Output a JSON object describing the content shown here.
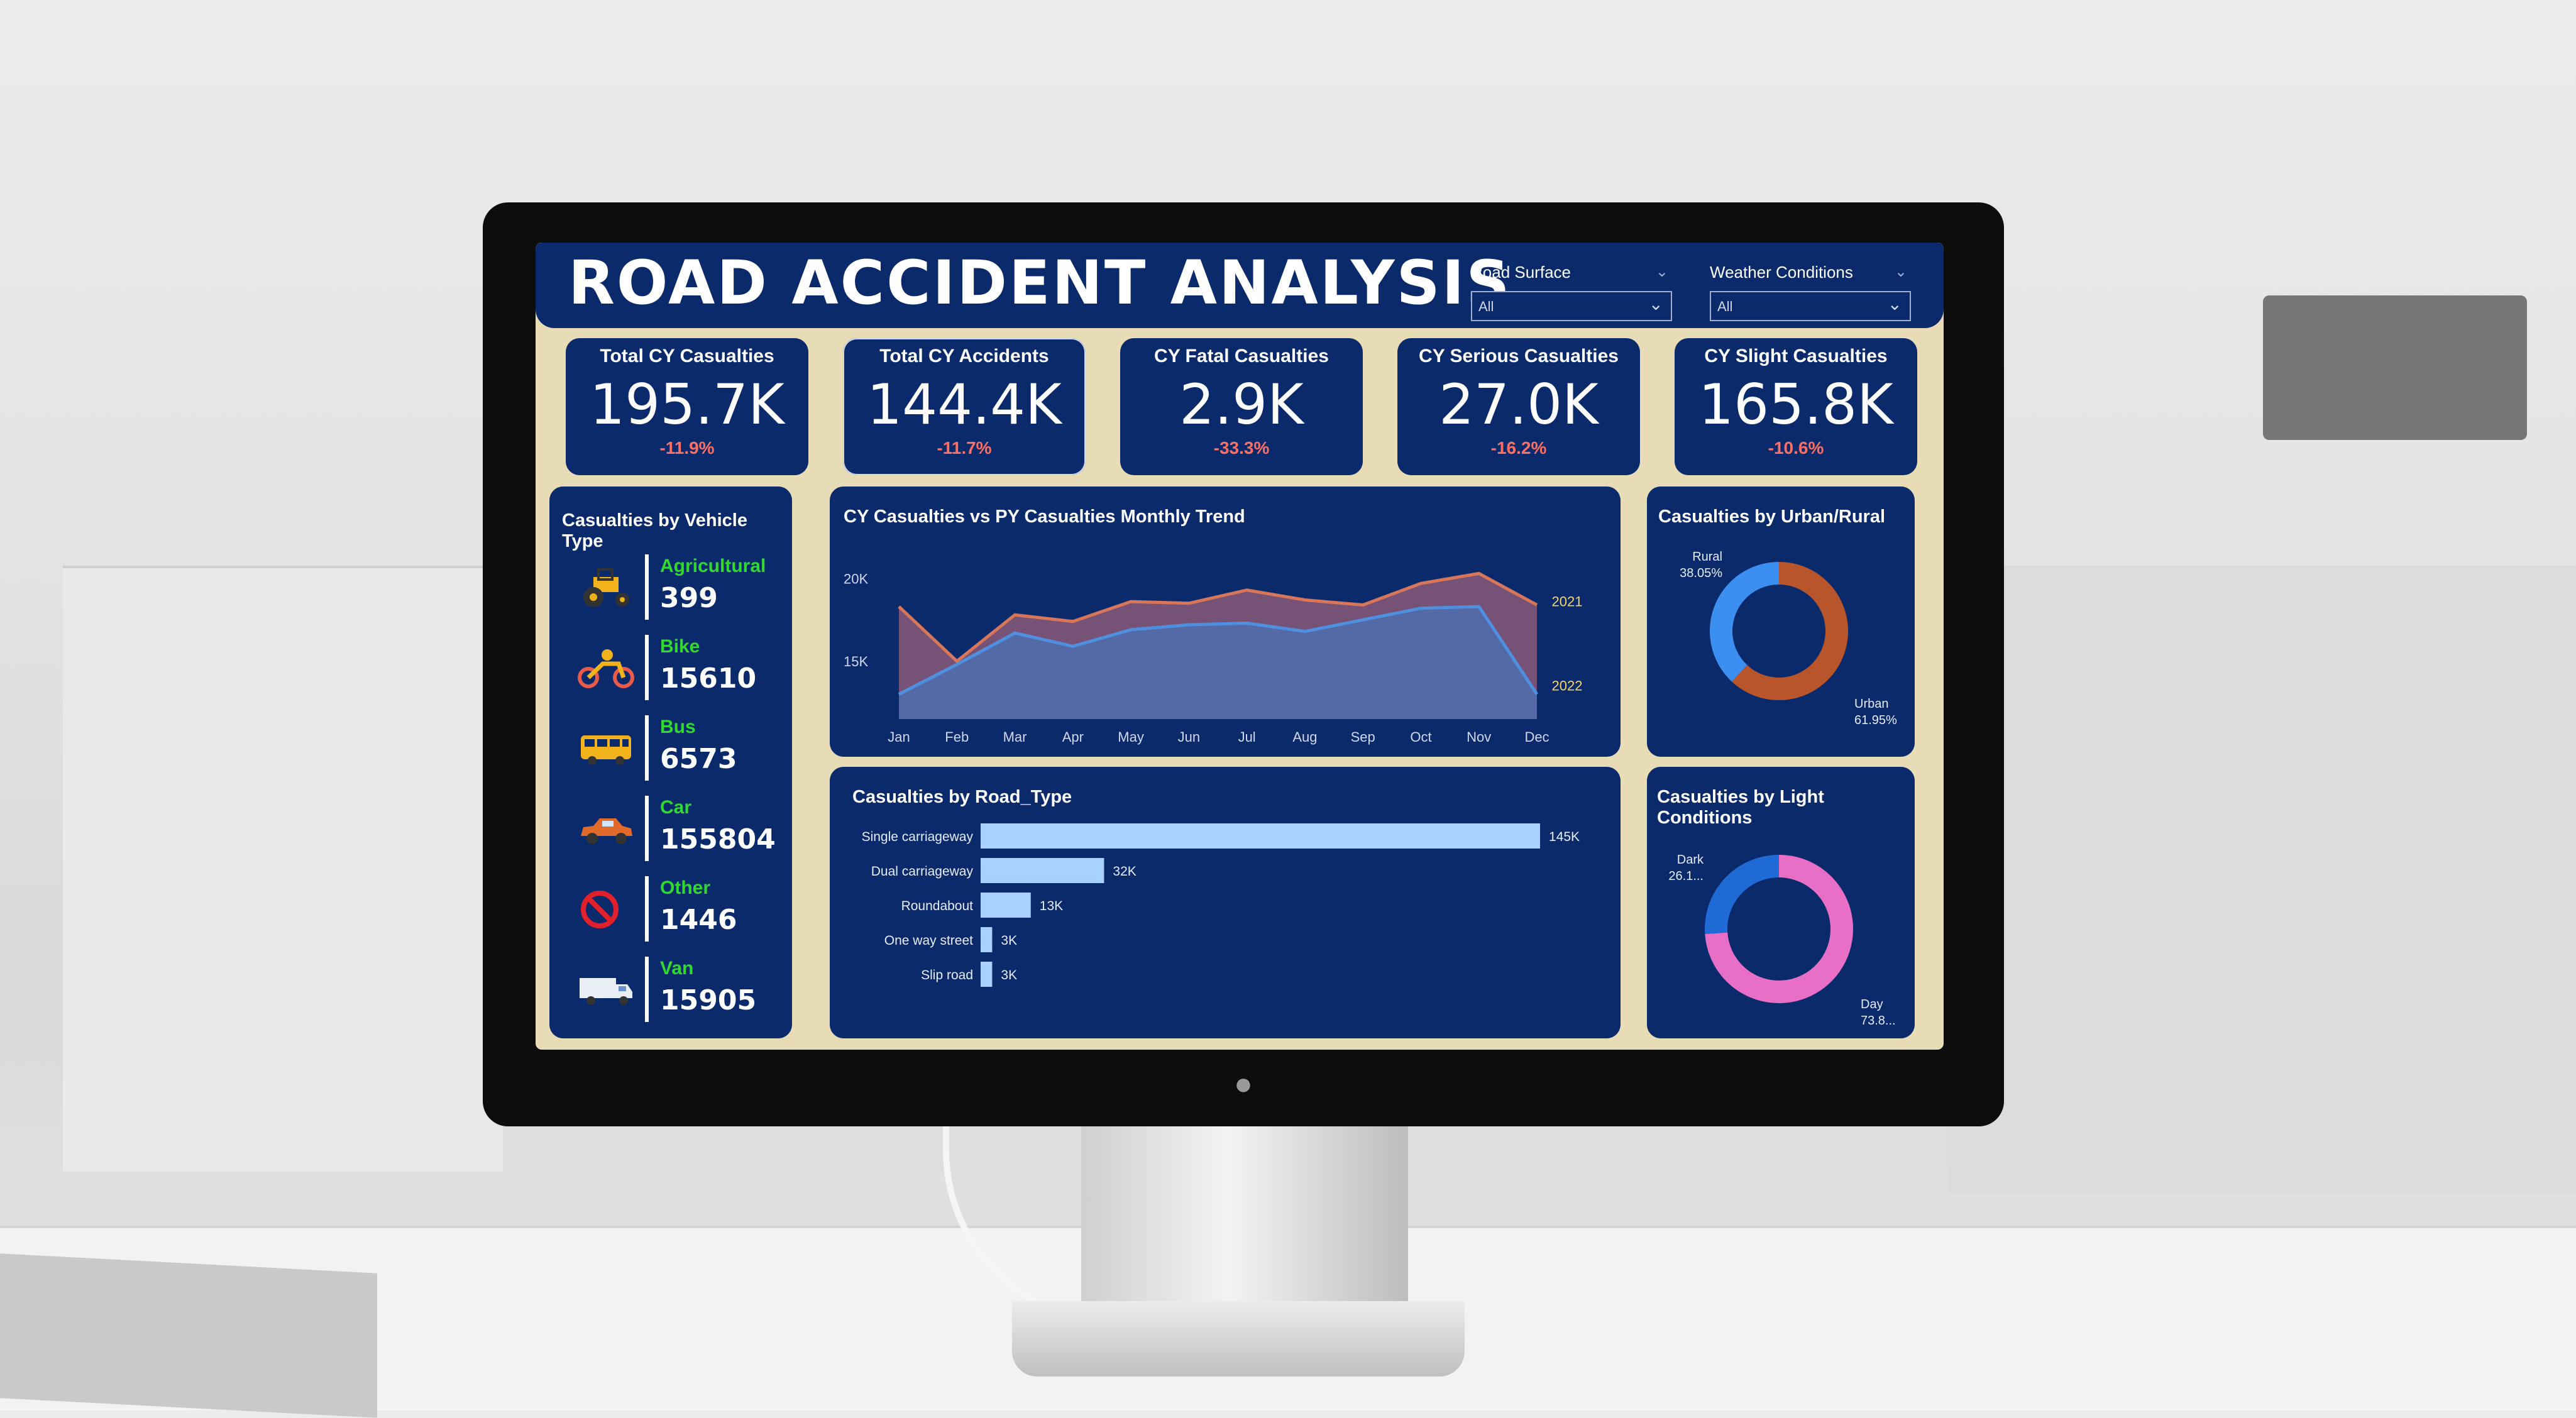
{
  "dashboard": {
    "title": "ROAD ACCIDENT ANALYSIS",
    "filters": [
      {
        "label": "Road Surface",
        "value": "All"
      },
      {
        "label": "Weather Conditions",
        "value": "All"
      }
    ],
    "kpis": [
      {
        "title": "Total CY Casualties",
        "value": "195.7K",
        "delta": "-11.9%"
      },
      {
        "title": "Total CY Accidents",
        "value": "144.4K",
        "delta": "-11.7%"
      },
      {
        "title": "CY Fatal Casualties",
        "value": "2.9K",
        "delta": "-33.3%"
      },
      {
        "title": "CY Serious Casualties",
        "value": "27.0K",
        "delta": "-16.2%"
      },
      {
        "title": "CY Slight Casualties",
        "value": "165.8K",
        "delta": "-10.6%"
      }
    ],
    "colors": {
      "panel": "#0b2a6b",
      "frame": "#e8dcb7",
      "negative": "#ff6f61",
      "label_green": "#30d930"
    }
  },
  "chart_data": [
    {
      "type": "table",
      "title": "Casualties by Vehicle Type",
      "rows": [
        {
          "category": "Agricultural",
          "value": "399",
          "icon": "tractor-icon"
        },
        {
          "category": "Bike",
          "value": "15610",
          "icon": "motorbike-icon"
        },
        {
          "category": "Bus",
          "value": "6573",
          "icon": "bus-icon"
        },
        {
          "category": "Car",
          "value": "155804",
          "icon": "car-icon"
        },
        {
          "category": "Other",
          "value": "1446",
          "icon": "prohibited-icon"
        },
        {
          "category": "Van",
          "value": "15905",
          "icon": "van-icon"
        }
      ]
    },
    {
      "type": "area",
      "title": "CY Casualties vs PY Casualties Monthly Trend",
      "categories": [
        "Jan",
        "Feb",
        "Mar",
        "Apr",
        "May",
        "Jun",
        "Jul",
        "Aug",
        "Sep",
        "Oct",
        "Nov",
        "Dec"
      ],
      "series": [
        {
          "name": "2021",
          "color": "#d8765a",
          "values": [
            18300,
            15000,
            17800,
            17400,
            18600,
            18500,
            19300,
            18700,
            18400,
            19700,
            20300,
            18400
          ]
        },
        {
          "name": "2022",
          "color": "#4f8fe0",
          "values": [
            13000,
            14800,
            16700,
            15900,
            16900,
            17200,
            17300,
            16800,
            17500,
            18200,
            18300,
            13000
          ]
        }
      ],
      "ylim": [
        11500,
        21000
      ],
      "yticks": [
        "15K",
        "20K"
      ],
      "ytick_values": [
        15000,
        20000
      ],
      "grid": false
    },
    {
      "type": "bar",
      "title": "Casualties by Road_Type",
      "categories": [
        "Single carriageway",
        "Dual carriageway",
        "Roundabout",
        "One way street",
        "Slip road"
      ],
      "values": [
        145000,
        32000,
        13000,
        3000,
        3000
      ],
      "labels": [
        "145K",
        "32K",
        "13K",
        "3K",
        "3K"
      ],
      "color": "#a9d1ff"
    },
    {
      "type": "pie",
      "title": "Casualties by Urban/Rural",
      "slices": [
        {
          "label": "Rural",
          "pct": "38.05%",
          "value": 38.05,
          "color": "#3a8ff0"
        },
        {
          "label": "Urban",
          "pct": "61.95%",
          "value": 61.95,
          "color": "#b8552b"
        }
      ]
    },
    {
      "type": "pie",
      "title": "Casualties by Light Conditions",
      "slices": [
        {
          "label": "Dark",
          "pct": "26.1...",
          "value": 26.1,
          "color": "#1f6ad4"
        },
        {
          "label": "Day",
          "pct": "73.8...",
          "value": 73.9,
          "color": "#e86fc6"
        }
      ]
    }
  ]
}
